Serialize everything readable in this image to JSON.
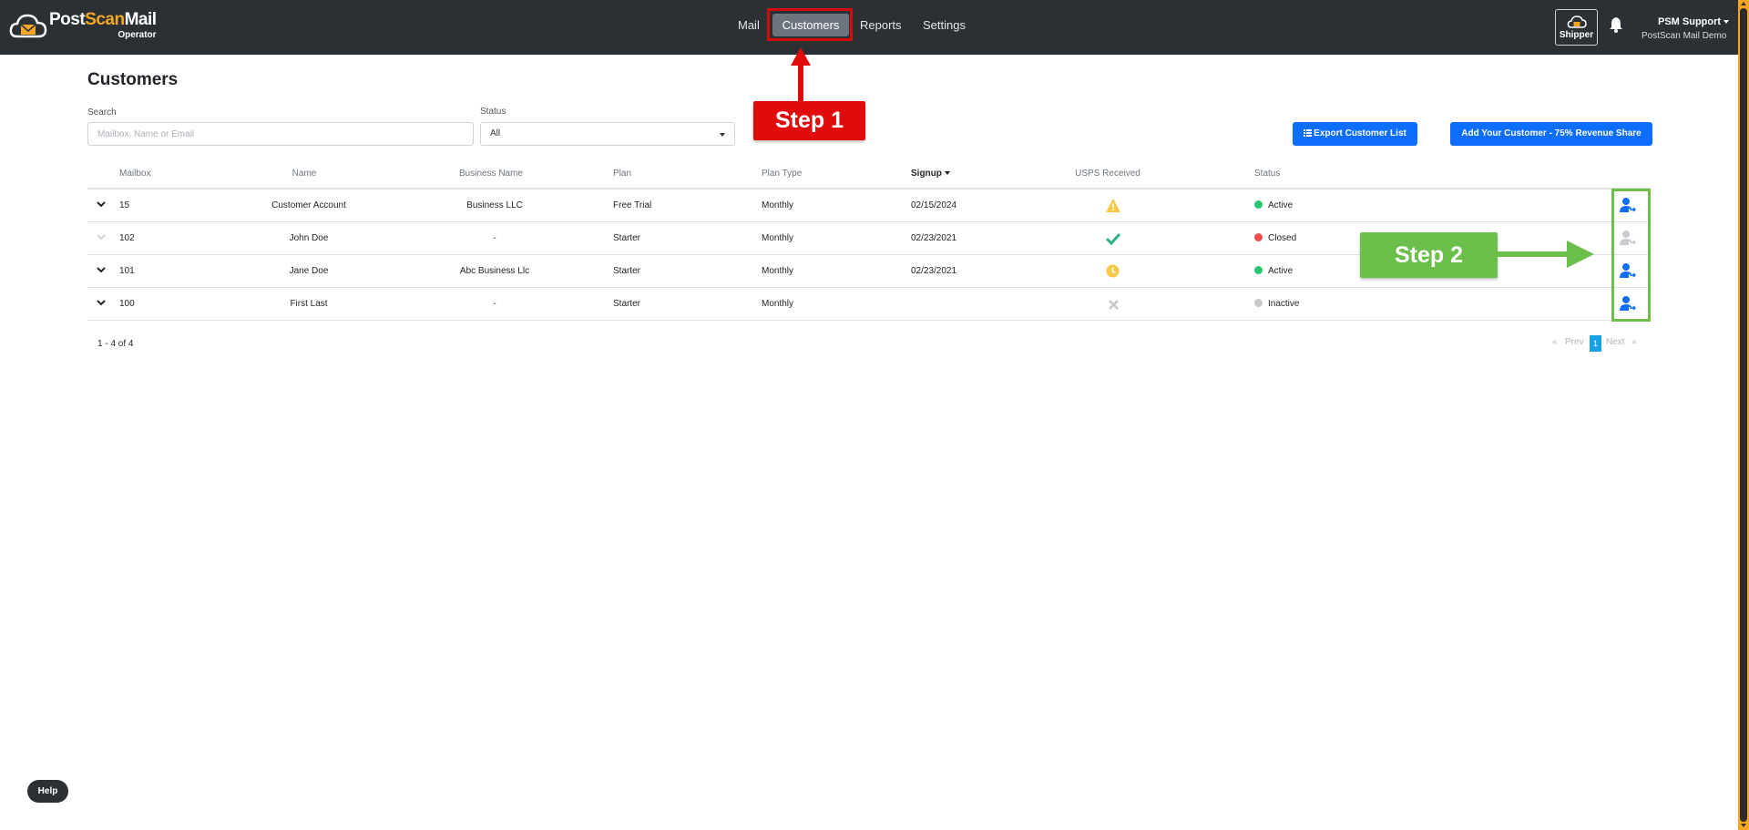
{
  "header": {
    "logo": {
      "name_part1": "Post",
      "name_part2": "Scan",
      "name_part3": "Mail",
      "subtitle": "Operator"
    },
    "nav": [
      {
        "label": "Mail"
      },
      {
        "label": "Customers",
        "active": true
      },
      {
        "label": "Reports"
      },
      {
        "label": "Settings"
      }
    ],
    "shipper_label": "Shipper",
    "user": {
      "name": "PSM Support",
      "org": "PostScan Mail Demo"
    },
    "icons": [
      "cloud-logo-icon",
      "shipper-icon",
      "bell-icon",
      "caret-down-icon"
    ]
  },
  "page": {
    "title": "Customers",
    "search": {
      "label": "Search",
      "placeholder": "Mailbox, Name or Email",
      "value": ""
    },
    "status": {
      "label": "Status",
      "value": "All"
    },
    "buttons": {
      "export": "Export Customer List",
      "add": "Add Your Customer - 75% Revenue Share"
    }
  },
  "annotations": {
    "step1": "Step 1",
    "step2": "Step 2",
    "step1_color": "#e00b0b",
    "step2_color": "#6bbf4a"
  },
  "table": {
    "columns": [
      "Mailbox",
      "Name",
      "Business Name",
      "Plan",
      "Plan Type",
      "Signup",
      "USPS Received",
      "Status"
    ],
    "sorted_by": "Signup",
    "rows": [
      {
        "mailbox": "15",
        "name": "Customer Account",
        "business": "Business LLC",
        "plan": "Free Trial",
        "plan_type": "Monthly",
        "signup": "02/15/2024",
        "usps": "warning-icon",
        "status": "Active",
        "status_color": "#28c76f",
        "enabled": true
      },
      {
        "mailbox": "102",
        "name": "John Doe",
        "business": "-",
        "plan": "Starter",
        "plan_type": "Monthly",
        "signup": "02/23/2021",
        "usps": "check-icon",
        "status": "Closed",
        "status_color": "#f04e4e",
        "enabled": false
      },
      {
        "mailbox": "101",
        "name": "Jane Doe",
        "business": "Abc Business Llc",
        "plan": "Starter",
        "plan_type": "Monthly",
        "signup": "02/23/2021",
        "usps": "clock-icon",
        "status": "Active",
        "status_color": "#28c76f",
        "enabled": true
      },
      {
        "mailbox": "100",
        "name": "First Last",
        "business": "-",
        "plan": "Starter",
        "plan_type": "Monthly",
        "signup": "",
        "usps": "x-icon",
        "status": "Inactive",
        "status_color": "#c8c8c8",
        "enabled": true
      }
    ]
  },
  "pagination": {
    "summary": "1 - 4 of 4",
    "first": "«",
    "prev": "Prev",
    "current": "1",
    "next": "Next",
    "last": "»"
  },
  "help_label": "Help",
  "colors": {
    "header_bg": "#2b3035",
    "primary": "#0d6efd",
    "accent": "#f5a623"
  }
}
